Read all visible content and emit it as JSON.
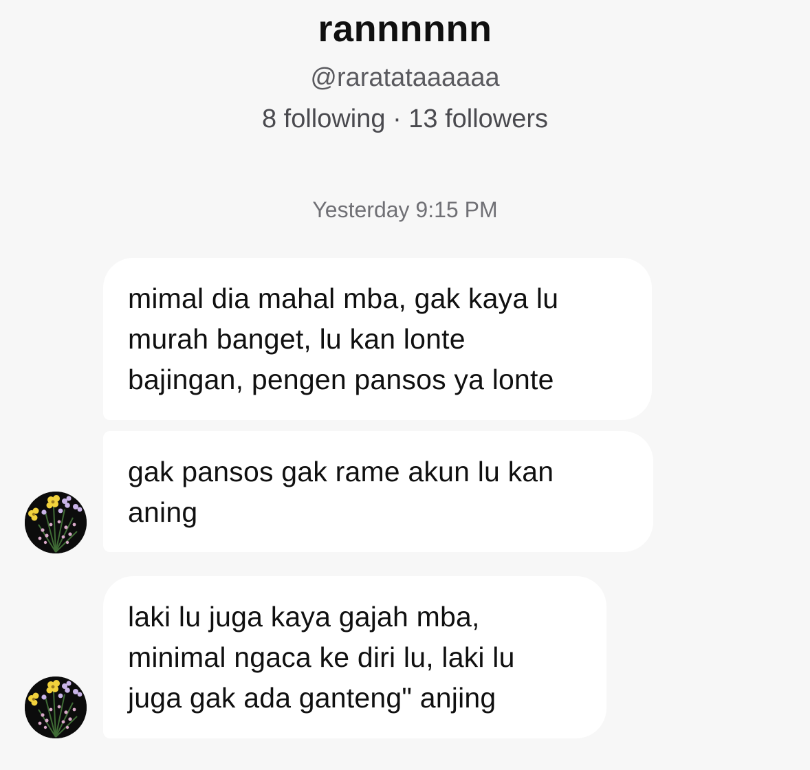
{
  "profile": {
    "display_name": "rannnnnn",
    "username": "@raratataaaaaa",
    "stats": "8 following · 13 followers"
  },
  "chat": {
    "timestamp": "Yesterday 9:15 PM",
    "messages": [
      {
        "sender": "other",
        "lines": [
          "mimal dia mahal mba, gak kaya lu",
          "murah banget, lu kan lonte",
          "bajingan, pengen pansos ya lonte"
        ]
      },
      {
        "sender": "other",
        "lines": [
          "gak pansos gak rame akun lu kan",
          "aning"
        ]
      },
      {
        "sender": "other",
        "lines": [
          "laki lu juga kaya gajah mba,",
          "minimal ngaca ke diri lu, laki lu",
          "juga gak ada ganteng\" anjing"
        ]
      }
    ]
  },
  "colors": {
    "background": "#f7f7f7",
    "bubble": "#ffffff",
    "avatar_background": "#0c0c0c",
    "flower_yellow": "#f2d23c",
    "flower_lilac": "#c9b4e8",
    "stem_green": "#3f6b35"
  },
  "icons": {
    "avatar": "flower-bouquet-avatar"
  }
}
